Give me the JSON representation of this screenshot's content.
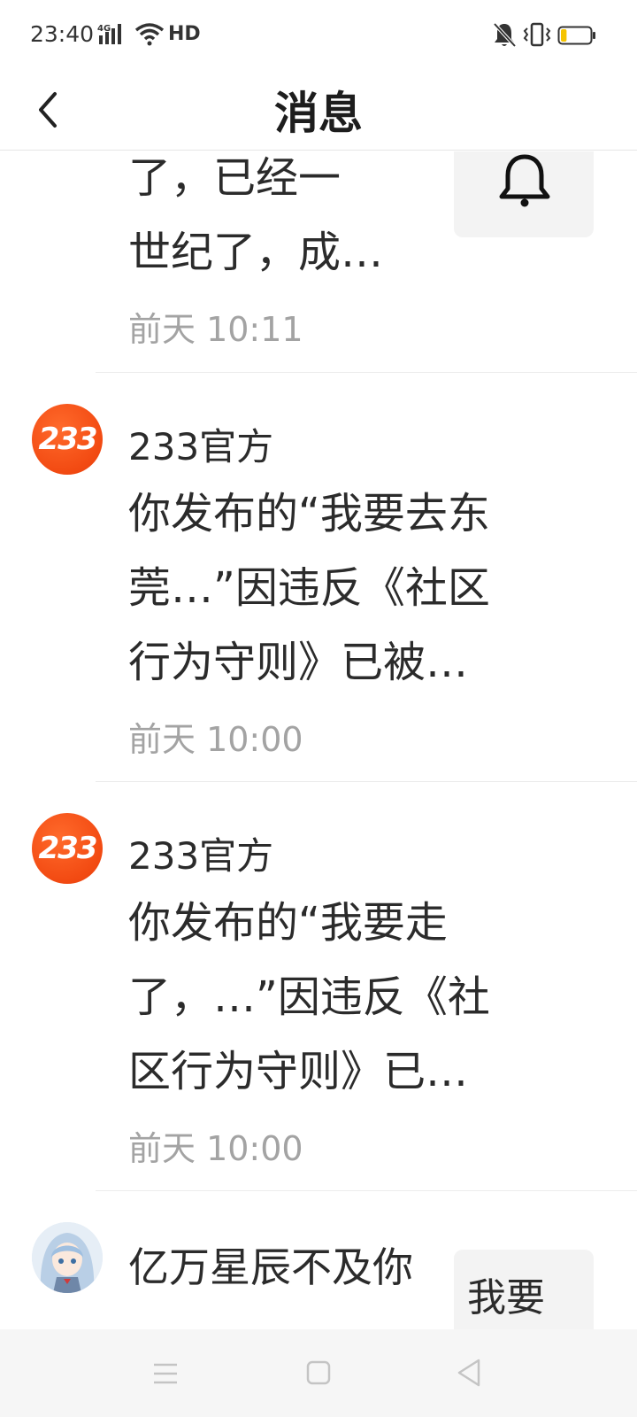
{
  "status_bar": {
    "time": "23:40",
    "network": "4G",
    "hd": "HD",
    "battery_level_percent": 20,
    "battery_color": "#f5c400"
  },
  "header": {
    "title": "消息",
    "back_icon": "chevron-left-icon"
  },
  "messages": [
    {
      "content_lines": [
        "了，已经一",
        "世纪了，成…"
      ],
      "time": "前天 10:11",
      "thumbnail": {
        "type": "icon",
        "icon": "bell-icon"
      }
    },
    {
      "avatar_text": "233",
      "sender": "233官方",
      "content_lines": [
        "你发布的“我要去东",
        "莞…”因违反《社区",
        "行为守则》已被…"
      ],
      "time": "前天 10:00"
    },
    {
      "avatar_text": "233",
      "sender": "233官方",
      "content_lines": [
        "你发布的“我要走",
        "了，…”因违反《社",
        "区行为守则》已…"
      ],
      "time": "前天 10:00"
    },
    {
      "avatar": "anime-avatar",
      "sender": "亿万星辰不及你",
      "thumbnail": {
        "type": "text",
        "text": "我要"
      }
    }
  ],
  "nav_bar": {
    "icons": [
      "menu-icon",
      "home-icon",
      "back-triangle-icon"
    ]
  },
  "colors": {
    "brand_orange": "#f24a12",
    "divider": "#ececec",
    "time_gray": "#a3a3a3"
  }
}
